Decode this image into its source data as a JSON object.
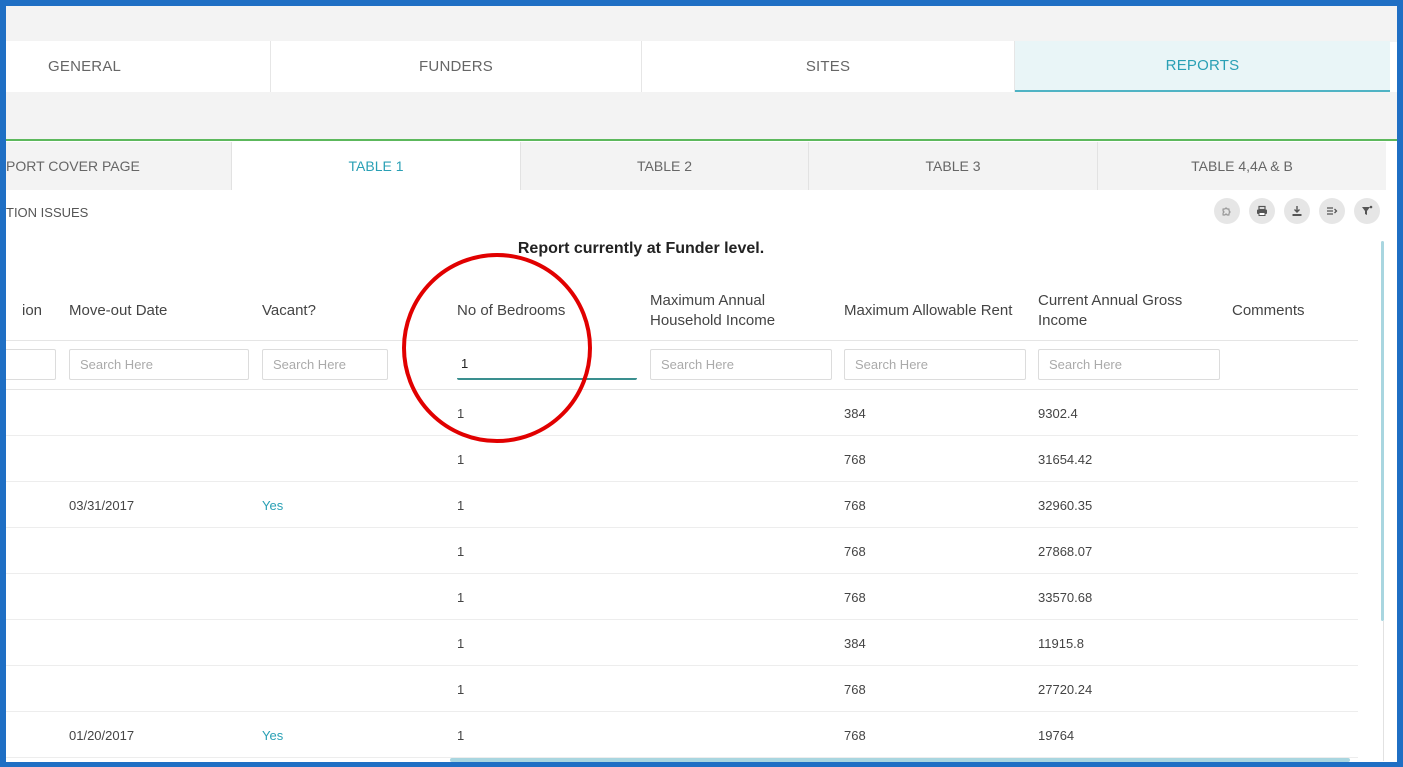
{
  "top_tabs": [
    {
      "label": "GENERAL"
    },
    {
      "label": "FUNDERS"
    },
    {
      "label": "SITES"
    },
    {
      "label": "REPORTS"
    }
  ],
  "sub_tabs": [
    {
      "label": "PORT COVER PAGE"
    },
    {
      "label": "TABLE 1"
    },
    {
      "label": "TABLE 2"
    },
    {
      "label": "TABLE 3"
    },
    {
      "label": "TABLE 4,4A & B"
    }
  ],
  "section_label": "TION ISSUES",
  "toolbar_icons": [
    "puzzle-icon",
    "print-icon",
    "download-icon",
    "columns-icon",
    "filter-icon"
  ],
  "report_level": "Report currently at Funder level.",
  "columns": [
    {
      "label": "ion"
    },
    {
      "label": "Move-out Date"
    },
    {
      "label": "Vacant?"
    },
    {
      "label": "No of Bedrooms"
    },
    {
      "label": "Maximum Annual Household Income"
    },
    {
      "label": "Maximum Allowable Rent"
    },
    {
      "label": "Current Annual Gross Income"
    },
    {
      "label": "Comments"
    }
  ],
  "search": {
    "placeholder": "Search Here",
    "bedrooms_value": "1"
  },
  "rows": [
    {
      "move_out": "",
      "vacant": "",
      "bedrooms": "1",
      "max_income": "",
      "max_rent": "384",
      "gross_income": "9302.4",
      "comments": ""
    },
    {
      "move_out": "",
      "vacant": "",
      "bedrooms": "1",
      "max_income": "",
      "max_rent": "768",
      "gross_income": "31654.42",
      "comments": ""
    },
    {
      "move_out": "03/31/2017",
      "vacant": "Yes",
      "bedrooms": "1",
      "max_income": "",
      "max_rent": "768",
      "gross_income": "32960.35",
      "comments": ""
    },
    {
      "move_out": "",
      "vacant": "",
      "bedrooms": "1",
      "max_income": "",
      "max_rent": "768",
      "gross_income": "27868.07",
      "comments": ""
    },
    {
      "move_out": "",
      "vacant": "",
      "bedrooms": "1",
      "max_income": "",
      "max_rent": "768",
      "gross_income": "33570.68",
      "comments": ""
    },
    {
      "move_out": "",
      "vacant": "",
      "bedrooms": "1",
      "max_income": "",
      "max_rent": "384",
      "gross_income": "11915.8",
      "comments": ""
    },
    {
      "move_out": "",
      "vacant": "",
      "bedrooms": "1",
      "max_income": "",
      "max_rent": "768",
      "gross_income": "27720.24",
      "comments": ""
    },
    {
      "move_out": "01/20/2017",
      "vacant": "Yes",
      "bedrooms": "1",
      "max_income": "",
      "max_rent": "768",
      "gross_income": "19764",
      "comments": ""
    }
  ],
  "colors": {
    "accent": "#2aa0b5",
    "frame": "#1f6fc4",
    "highlight_circle": "#e10000",
    "divider_green": "#5cb85c"
  }
}
